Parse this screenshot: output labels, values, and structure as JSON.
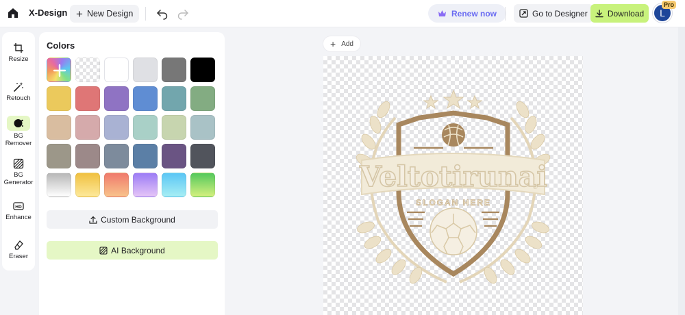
{
  "app": {
    "name": "X-Design"
  },
  "toolbar": {
    "new_design_label": "New Design",
    "renew_label": "Renew now",
    "go_to_designer_label": "Go to Designer",
    "download_label": "Download",
    "avatar_initial": "L",
    "pro_badge": "Pro"
  },
  "tools": [
    {
      "label": "Resize",
      "icon": "crop-icon"
    },
    {
      "label": "Retouch",
      "icon": "magic-wand-icon"
    },
    {
      "label": "BG Remover",
      "icon": "bg-remover-icon",
      "active": true
    },
    {
      "label": "BG Generator",
      "icon": "hatch-icon"
    },
    {
      "label": "Enhance",
      "icon": "hd-icon"
    },
    {
      "label": "Eraser",
      "icon": "eraser-icon"
    }
  ],
  "panel": {
    "title": "Colors",
    "custom_background_label": "Custom Background",
    "ai_background_label": "AI Background"
  },
  "swatches": [
    [
      "picker",
      "transparent",
      "#ffffff",
      "#dfe0e4",
      "#777777",
      "#000000"
    ],
    [
      "#ebc95c",
      "#df7676",
      "#8f73c3",
      "#5f8dd3",
      "#72a6ad",
      "#83ac82"
    ],
    [
      "#d9bda0",
      "#d5aaab",
      "#a9b2d3",
      "#a9d0c7",
      "#c7d5af",
      "#a9c2c6"
    ],
    [
      "#9c9789",
      "#9c8989",
      "#7d8b9c",
      "#5b7fa6",
      "#6a5483",
      "#51545c"
    ],
    [
      "grad-gray",
      "grad-yellow",
      "grad-red",
      "grad-purple",
      "grad-cyan",
      "grad-green"
    ]
  ],
  "canvas": {
    "add_label": "Add",
    "logo_title": "Veltotirunai",
    "logo_slogan": "SLOGAN HERE",
    "logo_color": "#a8875e",
    "logo_light": "#ece1c8",
    "registered_mark": "®"
  }
}
